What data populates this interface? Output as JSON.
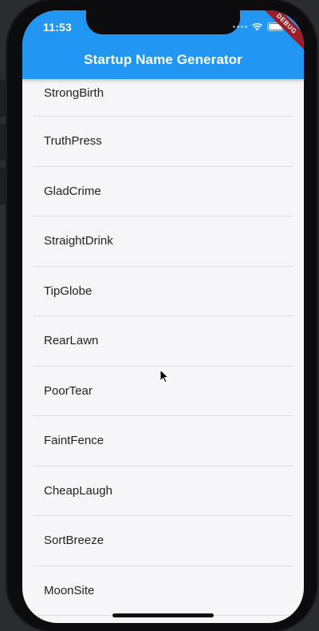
{
  "status_bar": {
    "time": "11:53"
  },
  "debug_banner": "DEBUG",
  "app_bar": {
    "title": "Startup Name Generator",
    "color": "#2196f3"
  },
  "list": {
    "items": [
      "StrongBirth",
      "TruthPress",
      "GladCrime",
      "StraightDrink",
      "TipGlobe",
      "RearLawn",
      "PoorTear",
      "FaintFence",
      "CheapLaugh",
      "SortBreeze",
      "MoonSite"
    ]
  }
}
